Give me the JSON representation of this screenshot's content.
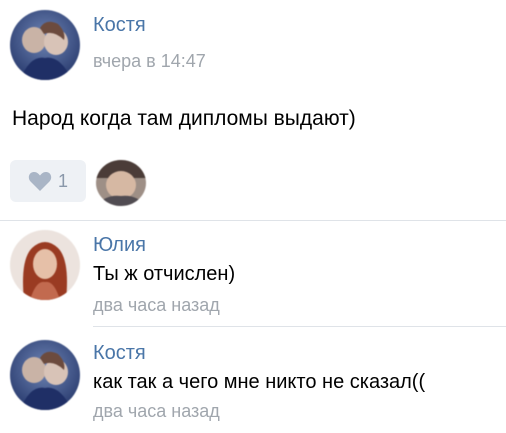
{
  "post": {
    "author": "Костя",
    "time": "вчера в 14:47",
    "text": "Народ когда там дипломы выдают)",
    "like_count": "1"
  },
  "comments": [
    {
      "author": "Юлия",
      "text": "Ты ж отчислен)",
      "time": "два часа назад"
    },
    {
      "author": "Костя",
      "text": "как так а чего мне никто не сказал((",
      "time": "два часа назад"
    }
  ],
  "icons": {
    "like": "heart-icon"
  },
  "colors": {
    "author_name": "#4a76a8",
    "meta_text": "#a0a6ad",
    "like_bg": "#eef1f5",
    "like_fg": "#8a98aa",
    "divider": "#dfe3e8"
  }
}
